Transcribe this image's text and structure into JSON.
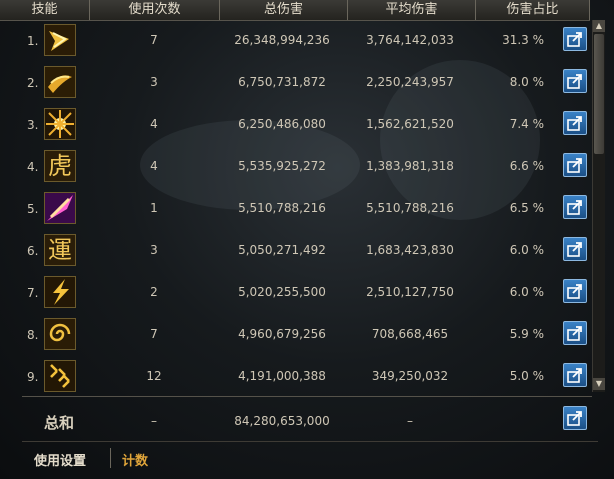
{
  "header": {
    "skill": "技能",
    "uses": "使用次数",
    "total_damage": "总伤害",
    "avg_damage": "平均伤害",
    "damage_share": "伤害占比"
  },
  "rows": [
    {
      "rank": "1.",
      "icon": "slash-arrow-skill-icon",
      "uses": "7",
      "total": "26,348,994,236",
      "avg": "3,764,142,033",
      "pct": "31.3 %"
    },
    {
      "rank": "2.",
      "icon": "wind-swirl-skill-icon",
      "uses": "3",
      "total": "6,750,731,872",
      "avg": "2,250,243,957",
      "pct": "8.0 %"
    },
    {
      "rank": "3.",
      "icon": "burst-skill-icon",
      "uses": "4",
      "total": "6,250,486,080",
      "avg": "1,562,621,520",
      "pct": "7.4 %"
    },
    {
      "rank": "4.",
      "icon": "tiger-glyph-skill-icon",
      "glyph": "虎",
      "uses": "4",
      "total": "5,535,925,272",
      "avg": "1,383,981,318",
      "pct": "6.6 %"
    },
    {
      "rank": "5.",
      "icon": "purple-slash-skill-icon",
      "uses": "1",
      "total": "5,510,788,216",
      "avg": "5,510,788,216",
      "pct": "6.5 %"
    },
    {
      "rank": "6.",
      "icon": "luck-glyph-skill-icon",
      "glyph": "運",
      "uses": "3",
      "total": "5,050,271,492",
      "avg": "1,683,423,830",
      "pct": "6.0 %"
    },
    {
      "rank": "7.",
      "icon": "lightning-skill-icon",
      "uses": "2",
      "total": "5,020,255,500",
      "avg": "2,510,127,750",
      "pct": "6.0 %"
    },
    {
      "rank": "8.",
      "icon": "spiral-skill-icon",
      "uses": "7",
      "total": "4,960,679,256",
      "avg": "708,668,465",
      "pct": "5.9 %"
    },
    {
      "rank": "9.",
      "icon": "triple-slash-skill-icon",
      "uses": "12",
      "total": "4,191,000,388",
      "avg": "349,250,032",
      "pct": "5.0 %"
    }
  ],
  "summary": {
    "label": "总和",
    "uses": "–",
    "total": "84,280,653,000",
    "avg": "–"
  },
  "footer": {
    "settings": "使用设置",
    "count": "计数"
  },
  "colors": {
    "accent_gold": "#e0a53a",
    "button_blue": "#2a69a8"
  }
}
